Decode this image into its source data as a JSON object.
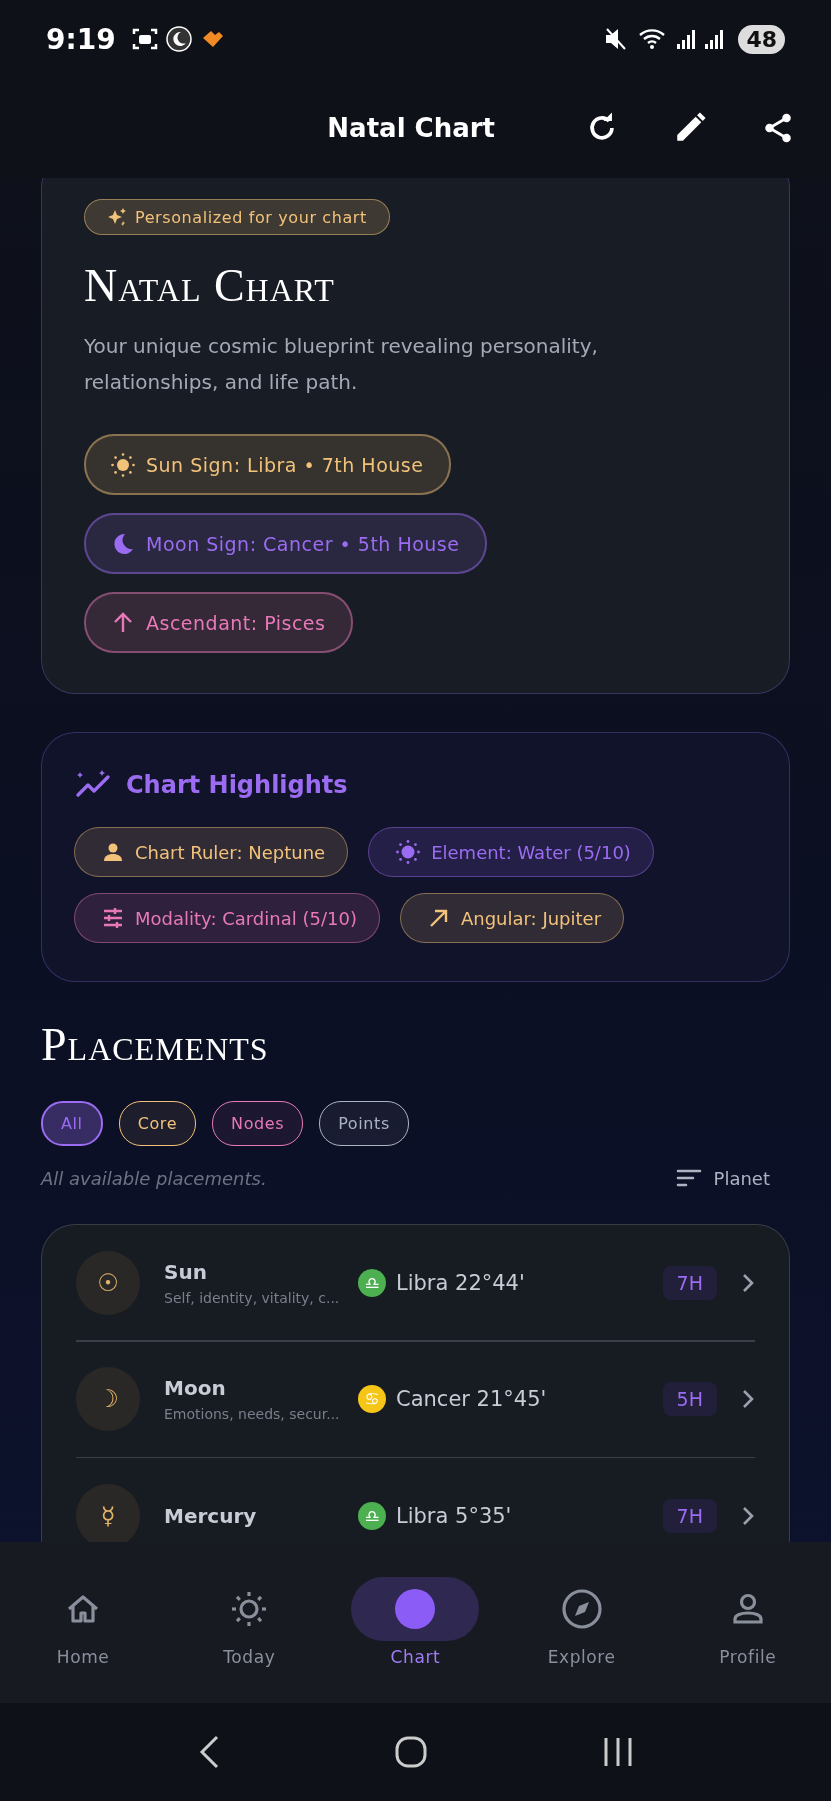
{
  "status_bar": {
    "time": "9:19",
    "battery": "48"
  },
  "header": {
    "title": "Natal Chart"
  },
  "hero": {
    "badge": "Personalized for your chart",
    "title": "Natal Chart",
    "description": "Your unique cosmic blueprint revealing personality, relationships, and life path.",
    "chips": [
      {
        "kind": "sun",
        "label": "Sun Sign: Libra • 7th House",
        "color": "#f2c27a"
      },
      {
        "kind": "moon",
        "label": "Moon Sign: Cancer • 5th House",
        "color": "#9b6cf2"
      },
      {
        "kind": "rising",
        "label": "Ascendant: Pisces",
        "color": "#e879b9"
      }
    ]
  },
  "highlights": {
    "title": "Chart Highlights",
    "chips": [
      {
        "kind": "ruler",
        "label": "Chart Ruler: Neptune",
        "color": "#f2c27a"
      },
      {
        "kind": "element",
        "label": "Element: Water (5/10)",
        "color": "#9b6cf2"
      },
      {
        "kind": "modality",
        "label": "Modality: Cardinal (5/10)",
        "color": "#e879b9"
      },
      {
        "kind": "angular",
        "label": "Angular: Jupiter",
        "color": "#f2c27a"
      }
    ]
  },
  "placements": {
    "title": "Placements",
    "filters": [
      {
        "label": "All",
        "selected": true,
        "color": "#9b6cf2"
      },
      {
        "label": "Core",
        "selected": false,
        "color": "#f2c27a"
      },
      {
        "label": "Nodes",
        "selected": false,
        "color": "#e879b9"
      },
      {
        "label": "Points",
        "selected": false,
        "color": "#aeb3c2"
      }
    ],
    "subtitle": "All available placements.",
    "sort": "Planet",
    "rows": [
      {
        "glyph": "☉",
        "name": "Sun",
        "description": "Self, identity, vitality, c...",
        "sign_glyph": "♎",
        "color": "#4caf50",
        "sign": "Libra 22°44'",
        "house": "7H"
      },
      {
        "glyph": "☽",
        "name": "Moon",
        "description": "Emotions, needs, secur...",
        "sign_glyph": "♋",
        "color": "#f5c518",
        "sign": "Cancer 21°45'",
        "house": "5H"
      },
      {
        "glyph": "☿",
        "name": "Mercury",
        "sign_glyph": "♎",
        "color": "#4caf50",
        "sign": "Libra 5°35'",
        "house": "7H"
      }
    ]
  },
  "nav": [
    {
      "kind": "home",
      "label": "Home",
      "selected": false
    },
    {
      "kind": "today",
      "label": "Today",
      "selected": false
    },
    {
      "kind": "chart",
      "label": "Chart",
      "selected": true
    },
    {
      "kind": "explore",
      "label": "Explore",
      "selected": false
    },
    {
      "kind": "profile",
      "label": "Profile",
      "selected": false
    }
  ]
}
